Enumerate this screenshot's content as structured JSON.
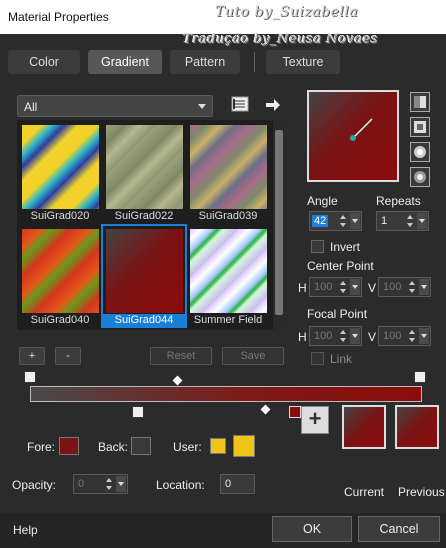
{
  "window": {
    "title": "Material Properties"
  },
  "watermark": {
    "line1": "Tuto by_Suizabella",
    "line2": "Tradução by_Neusa Novaes"
  },
  "tabs": [
    {
      "label": "Color",
      "active": false
    },
    {
      "label": "Gradient",
      "active": true
    },
    {
      "label": "Pattern",
      "active": false
    },
    {
      "label": "Texture",
      "active": false
    }
  ],
  "gradient_list": {
    "category": "All",
    "items": [
      {
        "name": "SuiGrad020",
        "selected": false
      },
      {
        "name": "SuiGrad022",
        "selected": false
      },
      {
        "name": "SuiGrad039",
        "selected": false
      },
      {
        "name": "SuiGrad040",
        "selected": false
      },
      {
        "name": "SuiGrad044",
        "selected": true
      },
      {
        "name": "Summer Field",
        "selected": false
      }
    ]
  },
  "list_buttons": {
    "add": "+",
    "remove": "-",
    "reset": "Reset",
    "save": "Save"
  },
  "settings": {
    "angle_label": "Angle",
    "angle": "42",
    "repeats_label": "Repeats",
    "repeats": "1",
    "invert_label": "Invert",
    "center_point_label": "Center Point",
    "center_h_label": "H",
    "center_h": "100",
    "center_v_label": "V",
    "center_v": "100",
    "focal_point_label": "Focal Point",
    "focal_h_label": "H",
    "focal_h": "100",
    "focal_v_label": "V",
    "focal_v": "100",
    "link_label": "Link"
  },
  "stops": {
    "fore_label": "Fore:",
    "back_label": "Back:",
    "user_label": "User:",
    "opacity_label": "Opacity:",
    "opacity": "0",
    "location_label": "Location:",
    "location": "0"
  },
  "swatches": {
    "current_label": "Current",
    "previous_label": "Previous"
  },
  "colors": {
    "accent": "#1a7fd6",
    "gradient_dark": "#8c0c0c",
    "user_yellow": "#f0c419"
  },
  "footer": {
    "help": "Help",
    "ok": "OK",
    "cancel": "Cancel"
  }
}
